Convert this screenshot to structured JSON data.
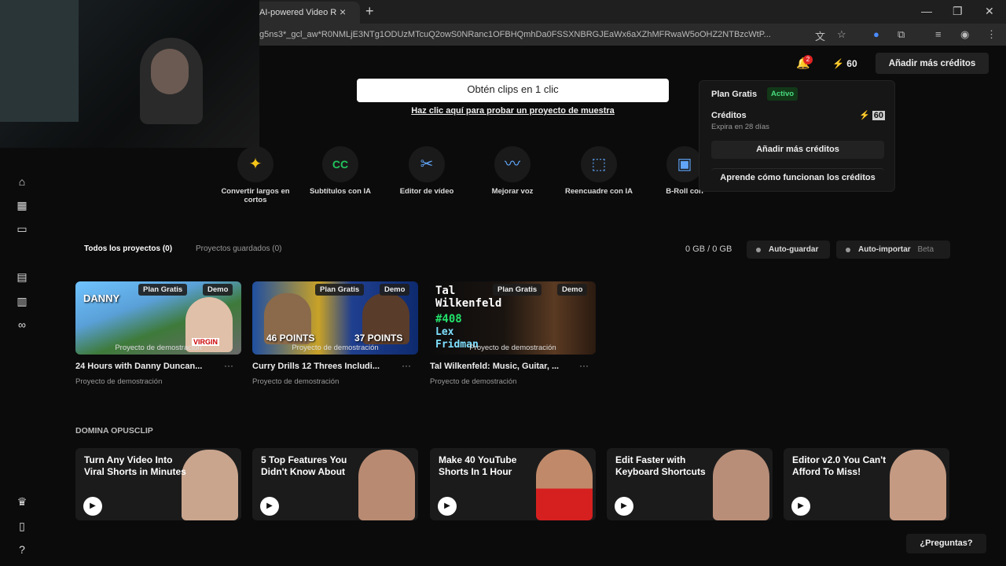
{
  "browser": {
    "tab_title": "AI-powered Video R",
    "url": "g5ns3*_gcl_aw*R0NMLjE3NTg1ODUzMTcuQ2owS0NRanc1OFBHQmhDa0FSSXNBRGJEaWx6aXZhMFRwaW5oOHZ2NTBzcWtP..."
  },
  "header": {
    "notification_count": "2",
    "credits": "60",
    "add_credits_label": "Añadir más créditos"
  },
  "hero": {
    "clip_button": "Obtén clips en 1 clic",
    "sample_link": "Haz clic aquí para probar un proyecto de muestra"
  },
  "tools": [
    {
      "label": "Convertir largos en cortos",
      "icon": "sparkle-icon",
      "color": "#f5c518"
    },
    {
      "label": "Subtítulos con IA",
      "icon": "cc-icon",
      "color": "#22c55e"
    },
    {
      "label": "Editor de vídeo",
      "icon": "scissors-icon",
      "color": "#3b82f6"
    },
    {
      "label": "Mejorar voz",
      "icon": "waveform-icon",
      "color": "#3b82f6"
    },
    {
      "label": "Reencuadre con IA",
      "icon": "crop-icon",
      "color": "#3b82f6"
    },
    {
      "label": "B-Roll con",
      "icon": "broll-icon",
      "color": "#3b82f6"
    }
  ],
  "projects": {
    "tab_all": "Todos los proyectos (0)",
    "tab_saved": "Proyectos guardados (0)",
    "storage": "0 GB / 0 GB",
    "auto_save": "Auto-guardar",
    "auto_import": "Auto-importar",
    "beta": "Beta",
    "tag_plan": "Plan Gratis",
    "tag_demo": "Demo",
    "caption": "Proyecto de demostración",
    "items": [
      {
        "title": "24 Hours with Danny Duncan...",
        "subtitle": "Proyecto de demostración"
      },
      {
        "title": "Curry Drills 12 Threes Includi...",
        "subtitle": "Proyecto de demostración"
      },
      {
        "title": "Tal Wilkenfeld: Music, Guitar, ...",
        "subtitle": "Proyecto de demostración"
      }
    ],
    "thumb_texts": {
      "danny": "DANNY",
      "virgin": "VIRGIN",
      "points_left": "46 POINTS",
      "points_right": "37 POINTS",
      "tal": "Tal Wilkenfeld",
      "num": "#408",
      "lex": "Lex Fridman"
    }
  },
  "learn": {
    "section_title": "DOMINA OPUSCLIP",
    "videos": [
      {
        "title": "Turn Any Video Into Viral Shorts in Minutes"
      },
      {
        "title": "5 Top Features You Didn't Know About"
      },
      {
        "title": "Make 40 YouTube Shorts In 1 Hour"
      },
      {
        "title": "Edit Faster with Keyboard Shortcuts"
      },
      {
        "title": "Editor v2.0 You Can't Afford To Miss!"
      }
    ]
  },
  "dropdown": {
    "plan": "Plan Gratis",
    "status": "Activo",
    "credits_label": "Créditos",
    "expires": "Expira en 28 días",
    "credits_value": "60",
    "add_button": "Añadir más créditos",
    "learn_button": "Aprende cómo funcionan los créditos"
  },
  "help_button": "¿Preguntas?"
}
